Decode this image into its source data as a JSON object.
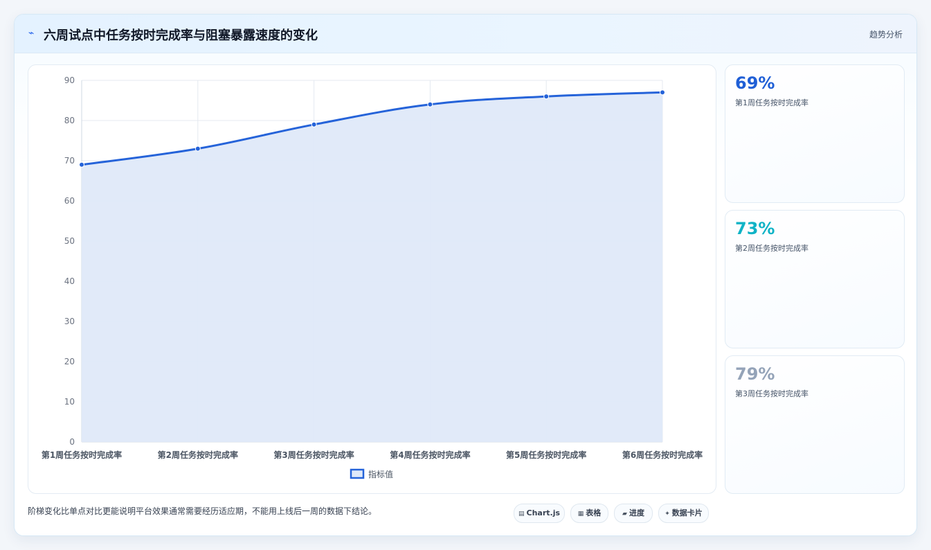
{
  "header": {
    "title": "六周试点中任务按时完成率与阻塞暴露速度的变化",
    "tag": "趋势分析",
    "icon": "trend-icon"
  },
  "chart_data": {
    "type": "area",
    "categories": [
      "第1周任务按时完成率",
      "第2周任务按时完成率",
      "第3周任务按时完成率",
      "第4周任务按时完成率",
      "第5周任务按时完成率",
      "第6周任务按时完成率"
    ],
    "series": [
      {
        "name": "指标值",
        "values": [
          69,
          73,
          79,
          84,
          86,
          87
        ],
        "color": "#2563d9"
      }
    ],
    "ylim": [
      0,
      90
    ],
    "yticks": [
      0,
      10,
      20,
      30,
      40,
      50,
      60,
      70,
      80,
      90
    ],
    "grid": true,
    "legend": "bottom",
    "fill_color": "#dfe9f9"
  },
  "side_cards": [
    {
      "value": "69%",
      "label": "第1周任务按时完成率",
      "color": "#1f5fd6"
    },
    {
      "value": "73%",
      "label": "第2周任务按时完成率",
      "color": "#10b3c6"
    },
    {
      "value": "79%",
      "label": "第3周任务按时完成率",
      "color": "#94a3b8"
    }
  ],
  "footer": {
    "note": "阶梯变化比单点对比更能说明平台效果通常需要经历适应期，不能用上线后一周的数据下结论。",
    "chips": [
      {
        "icon": "chart-icon",
        "label": "Chart.js"
      },
      {
        "icon": "table-icon",
        "label": "表格"
      },
      {
        "icon": "progress-icon",
        "label": "进度"
      },
      {
        "icon": "card-icon",
        "label": "数据卡片"
      }
    ]
  }
}
